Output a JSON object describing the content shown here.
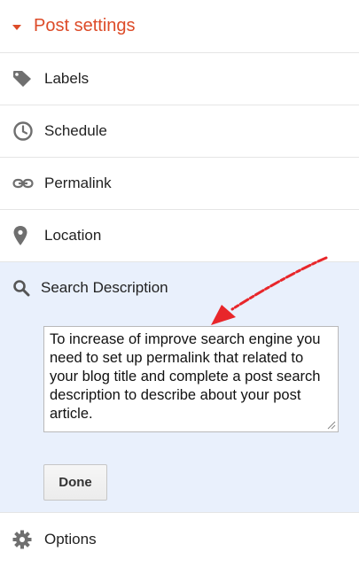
{
  "header": {
    "title": "Post settings"
  },
  "rows": [
    {
      "id": "labels",
      "label": "Labels",
      "icon": "tag-icon"
    },
    {
      "id": "schedule",
      "label": "Schedule",
      "icon": "clock-icon"
    },
    {
      "id": "permalink",
      "label": "Permalink",
      "icon": "link-icon"
    },
    {
      "id": "location",
      "label": "Location",
      "icon": "map-pin-icon"
    }
  ],
  "search_description": {
    "label": "Search Description",
    "icon": "search-icon",
    "text": "To increase of improve search engine you need to set up permalink that related to your blog title and complete a post search description to describe about your post article.",
    "done_label": "Done"
  },
  "options": {
    "label": "Options",
    "icon": "gear-icon"
  },
  "colors": {
    "accent": "#dd4b28",
    "expanded_bg": "#e9f0fc",
    "annotation_arrow": "#e8262a",
    "icon": "#6f6f6f"
  }
}
